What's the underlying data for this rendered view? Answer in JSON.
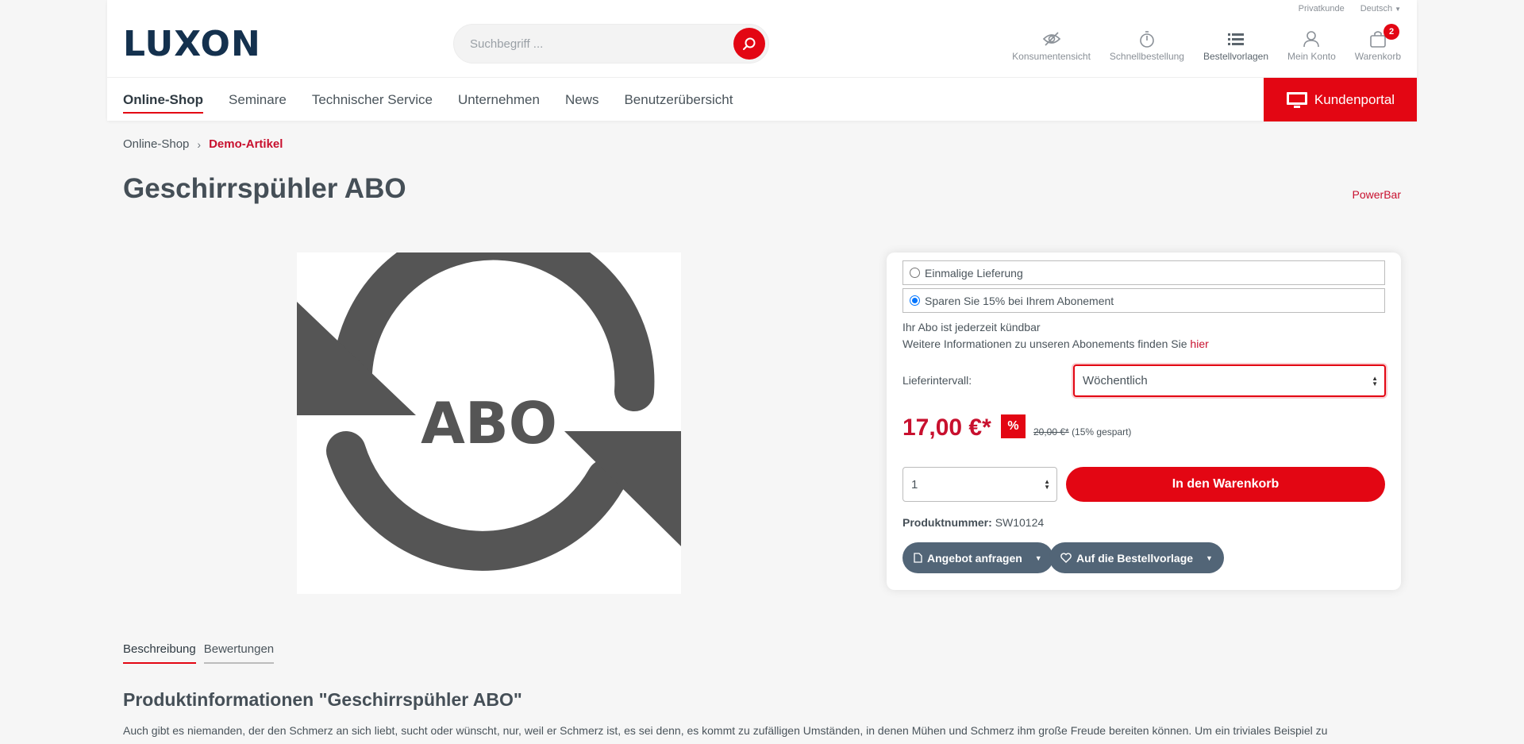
{
  "topbar": {
    "customer_type": "Privatkunde",
    "language": "Deutsch"
  },
  "header": {
    "logo": "LUXON",
    "search_placeholder": "Suchbegriff ...",
    "actions": [
      {
        "label": "Konsumentensicht",
        "icon": "eye-slash-icon"
      },
      {
        "label": "Schnellbestellung",
        "icon": "stopwatch-icon"
      },
      {
        "label": "Bestellvorlagen",
        "icon": "list-icon"
      },
      {
        "label": "Mein Konto",
        "icon": "user-icon"
      },
      {
        "label": "Warenkorb",
        "icon": "bag-icon",
        "badge": "2"
      }
    ]
  },
  "nav": {
    "items": [
      "Online-Shop",
      "Seminare",
      "Technischer Service",
      "Unternehmen",
      "News",
      "Benutzerübersicht"
    ],
    "active_index": 0,
    "portal_label": "Kundenportal"
  },
  "breadcrumb": {
    "parent": "Online-Shop",
    "current": "Demo-Artikel"
  },
  "product": {
    "title": "Geschirrspühler ABO",
    "manufacturer": "PowerBar",
    "image_text": "ABO",
    "option_once": "Einmalige Lieferung",
    "option_abo": "Sparen Sie 15% bei Ihrem Abonement",
    "info_1": "Ihr Abo ist jederzeit kündbar",
    "info_2": "Weitere Informationen zu unseren Abonements finden Sie ",
    "info_link": "hier",
    "interval_label": "Lieferintervall:",
    "interval_value": "Wöchentlich",
    "price": "17,00 €*",
    "discount_badge": "%",
    "old_price": "20,00 €*",
    "saving": "(15% gespart)",
    "quantity": "1",
    "add_to_cart": "In den Warenkorb",
    "number_label": "Produktnummer:",
    "number_value": "SW10124",
    "offer_button": "Angebot anfragen",
    "wishlist_button": "Auf die Bestellvorlage"
  },
  "tabs": {
    "description": "Beschreibung",
    "reviews": "Bewertungen"
  },
  "description": {
    "title": "Produktinformationen \"Geschirrspühler ABO\"",
    "text": "Auch gibt es niemanden, der den Schmerz an sich liebt, sucht oder wünscht, nur, weil er Schmerz ist, es sei denn, es kommt zu zufälligen Umständen, in denen Mühen und Schmerz ihm große Freude bereiten können. Um ein triviales Beispiel zu"
  },
  "colors": {
    "accent": "#e30613",
    "brand": "#14314e",
    "button_secondary": "#526577"
  }
}
